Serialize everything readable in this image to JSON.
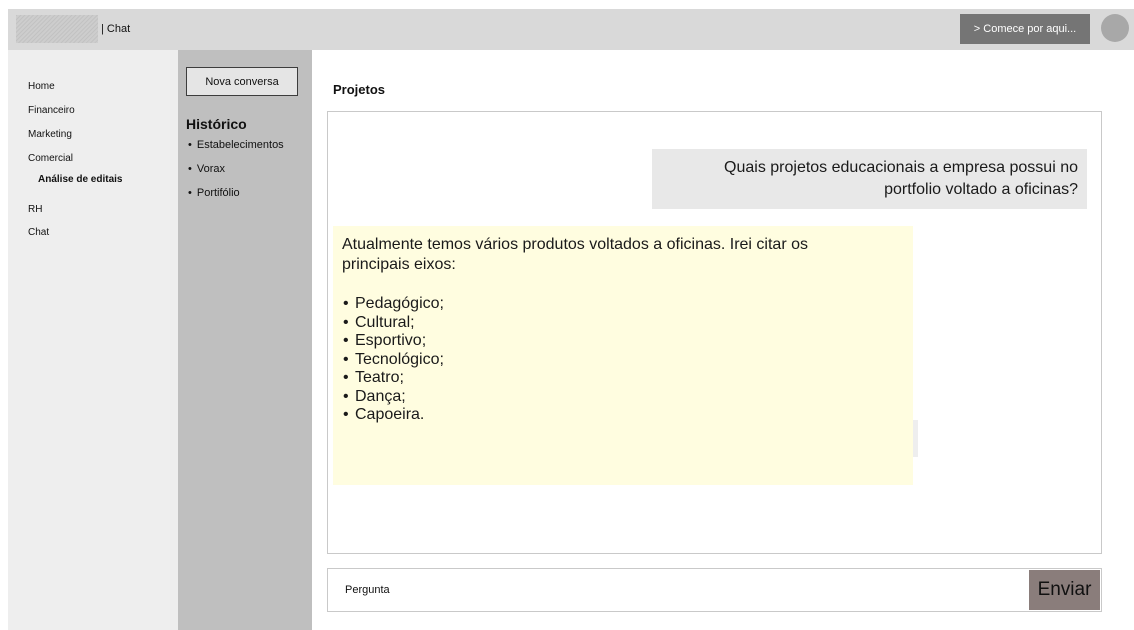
{
  "header": {
    "title": "| Chat",
    "cta_label": "> Comece por aqui..."
  },
  "sidebar": {
    "items": [
      {
        "label": "Home"
      },
      {
        "label": "Financeiro"
      },
      {
        "label": "Marketing"
      },
      {
        "label": "Comercial"
      },
      {
        "label": "Análise de editais"
      },
      {
        "label": "RH"
      },
      {
        "label": "Chat"
      }
    ]
  },
  "history": {
    "new_chat_label": "Nova conversa",
    "heading": "Histórico",
    "items": [
      {
        "label": "Estabelecimentos"
      },
      {
        "label": "Vorax"
      },
      {
        "label": "Portifólio"
      }
    ]
  },
  "chat": {
    "title": "Projetos",
    "user_message_line1": "Quais projetos educacionais a empresa possui no",
    "user_message_line2": "portfolio voltado a oficinas?",
    "bot_intro_line1": "Atualmente temos vários produtos voltados a oficinas. Irei citar os",
    "bot_intro_line2": "principais eixos:",
    "bot_items": [
      "Pedagógico;",
      "Cultural;",
      "Esportivo;",
      "Tecnológico;",
      "Teatro;",
      "Dança;",
      "Capoeira."
    ]
  },
  "input": {
    "placeholder": "Pergunta",
    "send_label": "Enviar"
  },
  "colors": {
    "topbar": "#d9d9d9",
    "sidebar": "#eeeeee",
    "history_panel": "#bfbfbf",
    "user_bubble": "#e8e8e8",
    "bot_bubble": "#fffde0",
    "send_button": "#8a7d7b",
    "cta_button": "#757575"
  }
}
